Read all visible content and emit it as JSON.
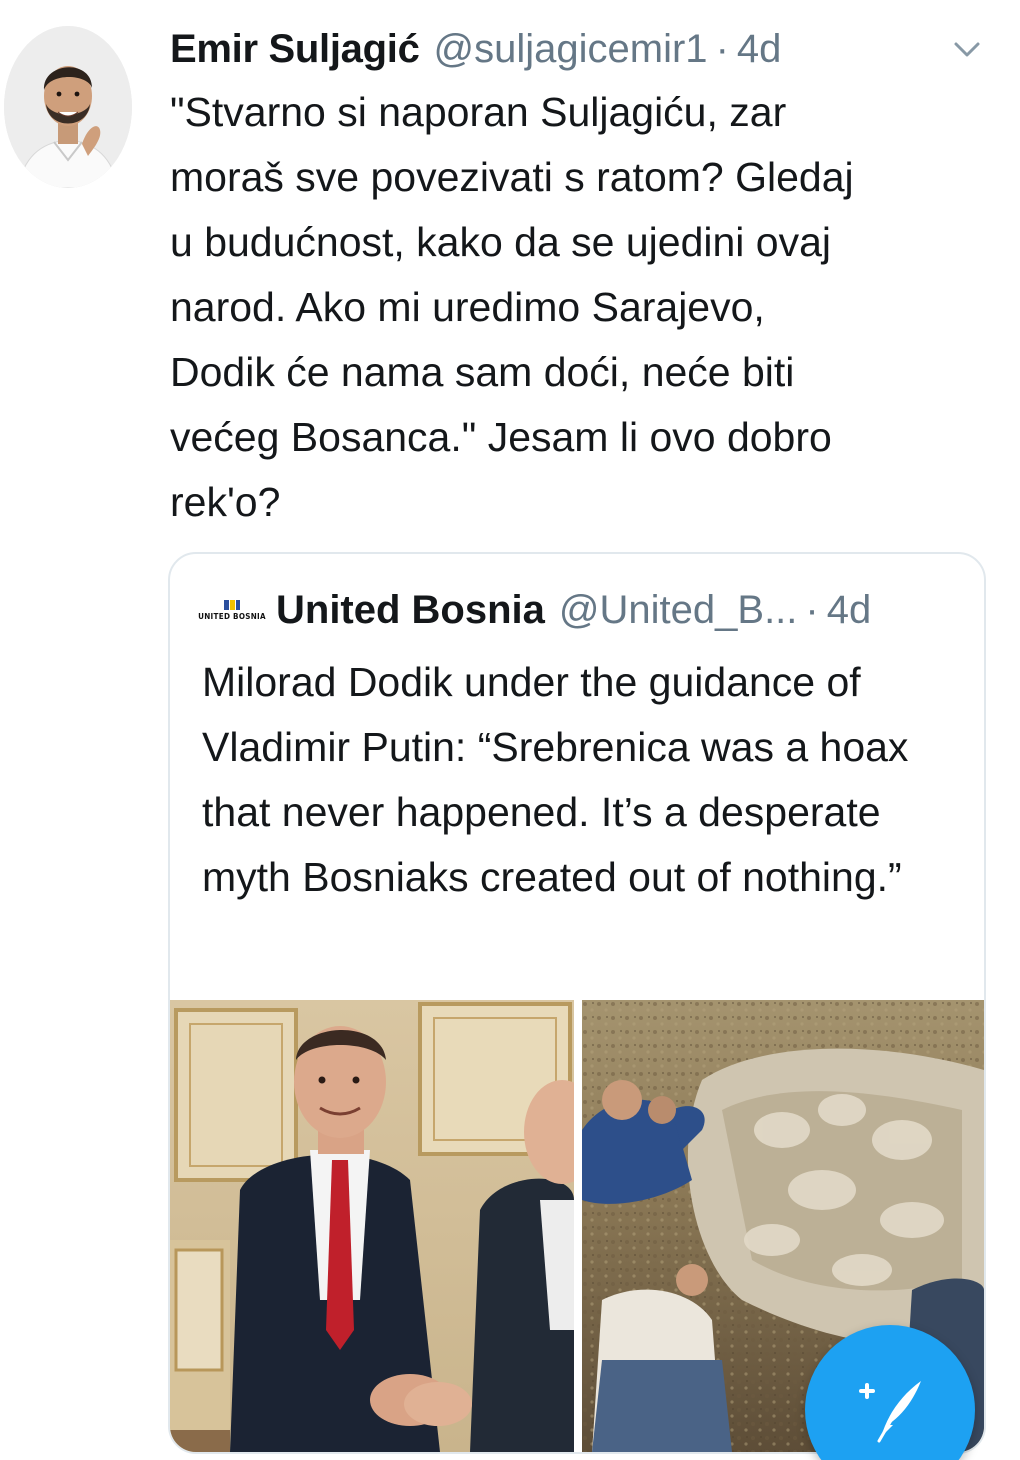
{
  "tweet": {
    "author_name": "Emir Suljagić",
    "author_handle": "@suljagicemir1",
    "separator": "·",
    "time": "4d",
    "text": "\"Stvarno si naporan Suljagiću, zar\nmoraš sve povezivati s ratom? Gledaj\nu budućnost, kako da se ujedini ovaj\nnarod. Ako mi uredimo Sarajevo,\nDodik će nama sam doći, neće biti\nvećeg Bosanca.\" Jesam li ovo dobro\nrek'o?"
  },
  "quoted_tweet": {
    "logo_text": "UNITED BOSNIA",
    "author_name": "United Bosnia",
    "author_handle": "@United_B...",
    "separator": "·",
    "time": "4d",
    "text": "Milorad Dodik under the guidance of Vladimir Putin: “Srebrenica was a hoax that never happened. It’s a desperate myth Bosniaks created out of nothing.”"
  },
  "icons": {
    "more": "chevron-down-icon",
    "compose": "compose-tweet-icon"
  },
  "colors": {
    "text_primary": "#14171a",
    "text_secondary": "#657786",
    "border": "#e1e8ed",
    "accent": "#1da1f2"
  }
}
